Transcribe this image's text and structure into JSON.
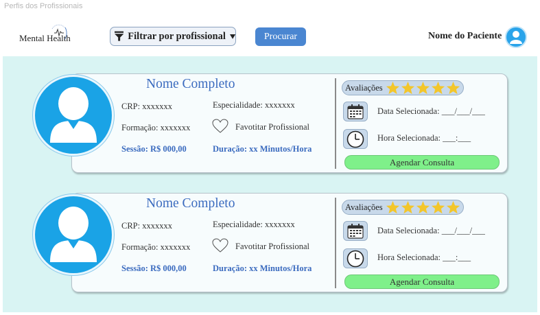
{
  "page": {
    "title": "Perfis dos Profissionais"
  },
  "header": {
    "logo_text": "Mental Health",
    "filter_label": "Filtrar por profissional",
    "search_label": "Procurar",
    "patient_name": "Nome do Paciente"
  },
  "colors": {
    "accent_blue": "#4a86d1",
    "avatar_blue": "#1aa3e6",
    "star_gold": "#f3c62b",
    "schedule_green": "#7ff08a",
    "background_teal": "#d9f4f3"
  },
  "cards": [
    {
      "name": "Nome Completo",
      "crp": "CRP: xxxxxxx",
      "specialty": "Especialidade: xxxxxxx",
      "education": "Formação: xxxxxxx",
      "favorite_label": "Favotitar Profissional",
      "session_price": "Sessão:  R$ 000,00",
      "duration": "Duração:  xx Minutos/Hora",
      "ratings_label": "Avaliações",
      "rating_stars": 5,
      "date_label": "Data Selecionada: ___/___/___",
      "time_label": "Hora Selecionada: ___:___",
      "schedule_label": "Agendar Consulta"
    },
    {
      "name": "Nome Completo",
      "crp": "CRP: xxxxxxx",
      "specialty": "Especialidade: xxxxxxx",
      "education": "Formação: xxxxxxx",
      "favorite_label": "Favotitar Profissional",
      "session_price": "Sessão:  R$ 000,00",
      "duration": "Duração:  xx Minutos/Hora",
      "ratings_label": "Avaliações",
      "rating_stars": 5,
      "date_label": "Data Selecionada: ___/___/___",
      "time_label": "Hora Selecionada: ___:___",
      "schedule_label": "Agendar Consulta"
    }
  ]
}
